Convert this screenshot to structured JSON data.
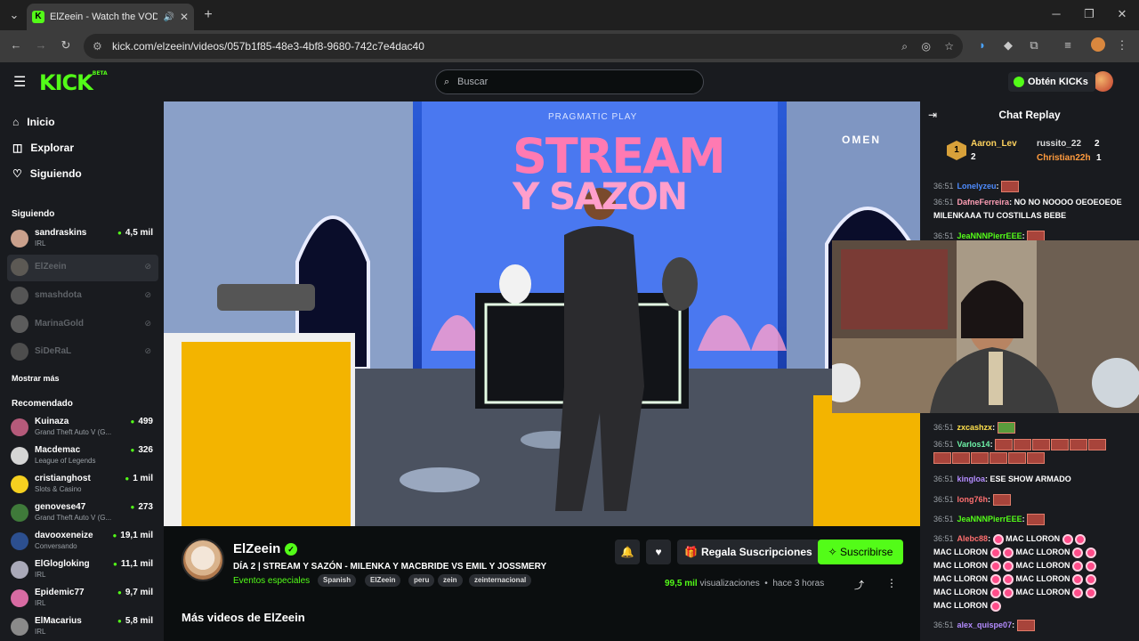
{
  "browser": {
    "tab_title": "ElZeein - Watch the VOD or",
    "url": "kick.com/elzeein/videos/057b1f85-48e3-4bf8-9680-742c7e4dac40"
  },
  "header": {
    "logo": "KICK",
    "logo_badge": "BETA",
    "search_placeholder": "Buscar",
    "get_kicks": "Obtén KICKs"
  },
  "sidebar": {
    "nav": [
      {
        "label": "Inicio",
        "icon": "home-icon"
      },
      {
        "label": "Explorar",
        "icon": "compass-icon"
      },
      {
        "label": "Siguiendo",
        "icon": "heart-icon"
      }
    ],
    "following_title": "Siguiendo",
    "following": [
      {
        "name": "sandraskins",
        "game": "IRL",
        "viewers": "4,5 mil",
        "live": true
      },
      {
        "name": "ElZeein",
        "live": false
      },
      {
        "name": "smashdota",
        "live": false
      },
      {
        "name": "MarinaGold",
        "live": false
      },
      {
        "name": "SiDeRaL",
        "live": false
      }
    ],
    "show_more": "Mostrar más",
    "recommended_title": "Recomendado",
    "recommended": [
      {
        "name": "Kuinaza",
        "game": "Grand Theft Auto V (G...",
        "viewers": "499"
      },
      {
        "name": "Macdemac",
        "game": "League of Legends",
        "viewers": "326"
      },
      {
        "name": "cristianghost",
        "game": "Slots & Casino",
        "viewers": "1 mil"
      },
      {
        "name": "genovese47",
        "game": "Grand Theft Auto V (G...",
        "viewers": "273"
      },
      {
        "name": "davooxeneize",
        "game": "Conversando",
        "viewers": "19,1 mil"
      },
      {
        "name": "ElGlogloking",
        "game": "IRL",
        "viewers": "11,1 mil"
      },
      {
        "name": "Epidemic77",
        "game": "IRL",
        "viewers": "9,7 mil"
      },
      {
        "name": "ElMacarius",
        "game": "IRL",
        "viewers": "5,8 mil"
      }
    ]
  },
  "video_overlay": {
    "sign_top": "PRAGMATIC PLAY",
    "sign_line1": "STREAM",
    "sign_line2": "Y SAZON",
    "sponsor": "OMEN"
  },
  "info": {
    "channel": "ElZeein",
    "title": "DÍA 2 | STREAM Y SAZÓN - MILENKA Y MACBRIDE VS EMIL Y JOSSMERY",
    "category": "Eventos especiales",
    "tags": [
      "Spanish",
      "ElZeein",
      "peru",
      "zein",
      "zeinternacional"
    ],
    "gift_label": "Regala Suscripciones",
    "subscribe_label": "Suscribirse",
    "views": "99,5 mil",
    "views_label": "visualizaciones",
    "ago": "hace 3 horas",
    "more_videos": "Más videos de ElZeein"
  },
  "chat": {
    "title": "Chat Replay",
    "top_gifters": [
      {
        "name": "Aaron_Lev",
        "count": "2"
      },
      {
        "name": "russito_22",
        "count": "2"
      },
      {
        "name": "Christian22h",
        "count": "1"
      }
    ],
    "messages": [
      {
        "time": "36:51",
        "user": "Lonelyzeu",
        "text": ""
      },
      {
        "time": "36:51",
        "user": "DafneFerreira",
        "text": "NO NO NOOOO OEOEOEOE MILENKAAA TU COSTILLAS BEBE"
      },
      {
        "time": "36:51",
        "user": "JeaNNNPierrEEE",
        "text": ""
      },
      {
        "time": "36:51",
        "user": "zxcashzx",
        "text": ""
      },
      {
        "time": "36:51",
        "user": "Varlos14",
        "text": ""
      },
      {
        "time": "36:51",
        "user": "kingloa",
        "text": "ESE SHOW ARMADO"
      },
      {
        "time": "36:51",
        "user": "long76h",
        "text": ""
      },
      {
        "time": "36:51",
        "user": "JeaNNNPierrEEE",
        "text": ""
      },
      {
        "time": "36:51",
        "user": "Alebc88",
        "text": "MAC LLORON"
      },
      {
        "time": "36:51",
        "user": "alex_quispe07",
        "text": ""
      }
    ],
    "repeat_text": "MAC LLORON"
  }
}
